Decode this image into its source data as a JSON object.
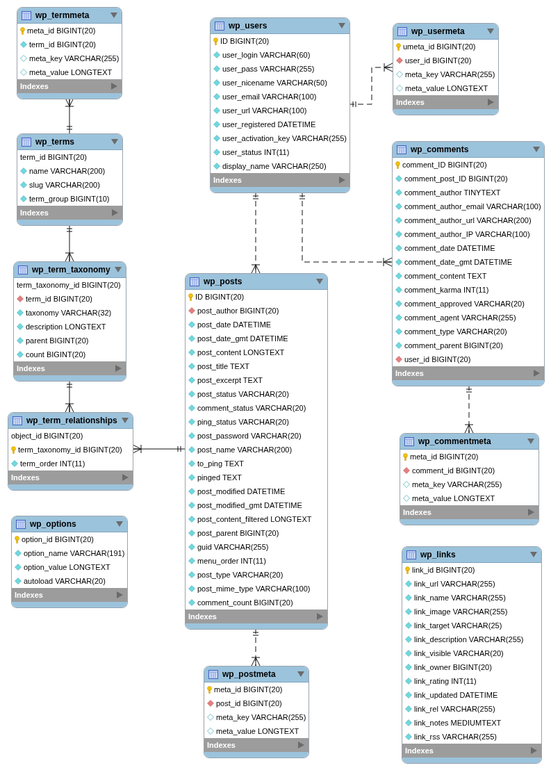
{
  "tables": [
    {
      "name": "wp_termmeta",
      "columns": [
        {
          "text": "meta_id BIGINT(20)",
          "kind": "pk"
        },
        {
          "text": "term_id BIGINT(20)",
          "kind": "col"
        },
        {
          "text": "meta_key VARCHAR(255)",
          "kind": "nullable"
        },
        {
          "text": "meta_value LONGTEXT",
          "kind": "nullable"
        }
      ],
      "indexes": "Indexes"
    },
    {
      "name": "wp_terms",
      "columns": [
        {
          "text": "term_id BIGINT(20)",
          "kind": "plain"
        },
        {
          "text": "name VARCHAR(200)",
          "kind": "col"
        },
        {
          "text": "slug VARCHAR(200)",
          "kind": "col"
        },
        {
          "text": "term_group BIGINT(10)",
          "kind": "col"
        }
      ],
      "indexes": "Indexes"
    },
    {
      "name": "wp_term_taxonomy",
      "columns": [
        {
          "text": "term_taxonomy_id BIGINT(20)",
          "kind": "plain"
        },
        {
          "text": "term_id BIGINT(20)",
          "kind": "fk"
        },
        {
          "text": "taxonomy VARCHAR(32)",
          "kind": "col"
        },
        {
          "text": "description LONGTEXT",
          "kind": "col"
        },
        {
          "text": "parent BIGINT(20)",
          "kind": "col"
        },
        {
          "text": "count BIGINT(20)",
          "kind": "col"
        }
      ],
      "indexes": "Indexes"
    },
    {
      "name": "wp_term_relationships",
      "columns": [
        {
          "text": "object_id BIGINT(20)",
          "kind": "plain"
        },
        {
          "text": "term_taxonomy_id BIGINT(20)",
          "kind": "pk"
        },
        {
          "text": "term_order INT(11)",
          "kind": "col"
        }
      ],
      "indexes": "Indexes"
    },
    {
      "name": "wp_options",
      "columns": [
        {
          "text": "option_id BIGINT(20)",
          "kind": "pk"
        },
        {
          "text": "option_name VARCHAR(191)",
          "kind": "col"
        },
        {
          "text": "option_value LONGTEXT",
          "kind": "col"
        },
        {
          "text": "autoload VARCHAR(20)",
          "kind": "col"
        }
      ],
      "indexes": "Indexes"
    },
    {
      "name": "wp_users",
      "columns": [
        {
          "text": "ID BIGINT(20)",
          "kind": "pk"
        },
        {
          "text": "user_login VARCHAR(60)",
          "kind": "col"
        },
        {
          "text": "user_pass VARCHAR(255)",
          "kind": "col"
        },
        {
          "text": "user_nicename VARCHAR(50)",
          "kind": "col"
        },
        {
          "text": "user_email VARCHAR(100)",
          "kind": "col"
        },
        {
          "text": "user_url VARCHAR(100)",
          "kind": "col"
        },
        {
          "text": "user_registered DATETIME",
          "kind": "col"
        },
        {
          "text": "user_activation_key VARCHAR(255)",
          "kind": "col"
        },
        {
          "text": "user_status INT(11)",
          "kind": "col"
        },
        {
          "text": "display_name VARCHAR(250)",
          "kind": "col"
        }
      ],
      "indexes": "Indexes"
    },
    {
      "name": "wp_posts",
      "columns": [
        {
          "text": "ID BIGINT(20)",
          "kind": "pk"
        },
        {
          "text": "post_author BIGINT(20)",
          "kind": "fk"
        },
        {
          "text": "post_date DATETIME",
          "kind": "col"
        },
        {
          "text": "post_date_gmt DATETIME",
          "kind": "col"
        },
        {
          "text": "post_content LONGTEXT",
          "kind": "col"
        },
        {
          "text": "post_title TEXT",
          "kind": "col"
        },
        {
          "text": "post_excerpt TEXT",
          "kind": "col"
        },
        {
          "text": "post_status VARCHAR(20)",
          "kind": "col"
        },
        {
          "text": "comment_status VARCHAR(20)",
          "kind": "col"
        },
        {
          "text": "ping_status VARCHAR(20)",
          "kind": "col"
        },
        {
          "text": "post_password VARCHAR(20)",
          "kind": "col"
        },
        {
          "text": "post_name VARCHAR(200)",
          "kind": "col"
        },
        {
          "text": "to_ping TEXT",
          "kind": "col"
        },
        {
          "text": "pinged TEXT",
          "kind": "col"
        },
        {
          "text": "post_modified DATETIME",
          "kind": "col"
        },
        {
          "text": "post_modified_gmt DATETIME",
          "kind": "col"
        },
        {
          "text": "post_content_filtered LONGTEXT",
          "kind": "col"
        },
        {
          "text": "post_parent BIGINT(20)",
          "kind": "col"
        },
        {
          "text": "guid VARCHAR(255)",
          "kind": "col"
        },
        {
          "text": "menu_order INT(11)",
          "kind": "col"
        },
        {
          "text": "post_type VARCHAR(20)",
          "kind": "col"
        },
        {
          "text": "post_mime_type VARCHAR(100)",
          "kind": "col"
        },
        {
          "text": "comment_count BIGINT(20)",
          "kind": "col"
        }
      ],
      "indexes": "Indexes"
    },
    {
      "name": "wp_postmeta",
      "columns": [
        {
          "text": "meta_id BIGINT(20)",
          "kind": "pk"
        },
        {
          "text": "post_id BIGINT(20)",
          "kind": "fk"
        },
        {
          "text": "meta_key VARCHAR(255)",
          "kind": "nullable"
        },
        {
          "text": "meta_value LONGTEXT",
          "kind": "nullable"
        }
      ],
      "indexes": "Indexes"
    },
    {
      "name": "wp_usermeta",
      "columns": [
        {
          "text": "umeta_id BIGINT(20)",
          "kind": "pk"
        },
        {
          "text": "user_id BIGINT(20)",
          "kind": "fk"
        },
        {
          "text": "meta_key VARCHAR(255)",
          "kind": "nullable"
        },
        {
          "text": "meta_value LONGTEXT",
          "kind": "nullable"
        }
      ],
      "indexes": "Indexes"
    },
    {
      "name": "wp_comments",
      "columns": [
        {
          "text": "comment_ID BIGINT(20)",
          "kind": "pk"
        },
        {
          "text": "comment_post_ID BIGINT(20)",
          "kind": "col"
        },
        {
          "text": "comment_author TINYTEXT",
          "kind": "col"
        },
        {
          "text": "comment_author_email VARCHAR(100)",
          "kind": "col"
        },
        {
          "text": "comment_author_url VARCHAR(200)",
          "kind": "col"
        },
        {
          "text": "comment_author_IP VARCHAR(100)",
          "kind": "col"
        },
        {
          "text": "comment_date DATETIME",
          "kind": "col"
        },
        {
          "text": "comment_date_gmt DATETIME",
          "kind": "col"
        },
        {
          "text": "comment_content TEXT",
          "kind": "col"
        },
        {
          "text": "comment_karma INT(11)",
          "kind": "col"
        },
        {
          "text": "comment_approved VARCHAR(20)",
          "kind": "col"
        },
        {
          "text": "comment_agent VARCHAR(255)",
          "kind": "col"
        },
        {
          "text": "comment_type VARCHAR(20)",
          "kind": "col"
        },
        {
          "text": "comment_parent BIGINT(20)",
          "kind": "col"
        },
        {
          "text": "user_id BIGINT(20)",
          "kind": "fk"
        }
      ],
      "indexes": "Indexes"
    },
    {
      "name": "wp_commentmeta",
      "columns": [
        {
          "text": "meta_id BIGINT(20)",
          "kind": "pk"
        },
        {
          "text": "comment_id BIGINT(20)",
          "kind": "fk"
        },
        {
          "text": "meta_key VARCHAR(255)",
          "kind": "nullable"
        },
        {
          "text": "meta_value LONGTEXT",
          "kind": "nullable"
        }
      ],
      "indexes": "Indexes"
    },
    {
      "name": "wp_links",
      "columns": [
        {
          "text": "link_id BIGINT(20)",
          "kind": "pk"
        },
        {
          "text": "link_url VARCHAR(255)",
          "kind": "col"
        },
        {
          "text": "link_name VARCHAR(255)",
          "kind": "col"
        },
        {
          "text": "link_image VARCHAR(255)",
          "kind": "col"
        },
        {
          "text": "link_target VARCHAR(25)",
          "kind": "col"
        },
        {
          "text": "link_description VARCHAR(255)",
          "kind": "col"
        },
        {
          "text": "link_visible VARCHAR(20)",
          "kind": "col"
        },
        {
          "text": "link_owner BIGINT(20)",
          "kind": "col"
        },
        {
          "text": "link_rating INT(11)",
          "kind": "col"
        },
        {
          "text": "link_updated DATETIME",
          "kind": "col"
        },
        {
          "text": "link_rel VARCHAR(255)",
          "kind": "col"
        },
        {
          "text": "link_notes MEDIUMTEXT",
          "kind": "col"
        },
        {
          "text": "link_rss VARCHAR(255)",
          "kind": "col"
        }
      ],
      "indexes": "Indexes"
    }
  ],
  "relationships": [
    {
      "identifying": true
    },
    {
      "identifying": true
    },
    {
      "identifying": true
    },
    {
      "identifying": true
    },
    {
      "identifying": false
    },
    {
      "identifying": false
    },
    {
      "identifying": false
    },
    {
      "identifying": false
    },
    {
      "identifying": false
    }
  ]
}
